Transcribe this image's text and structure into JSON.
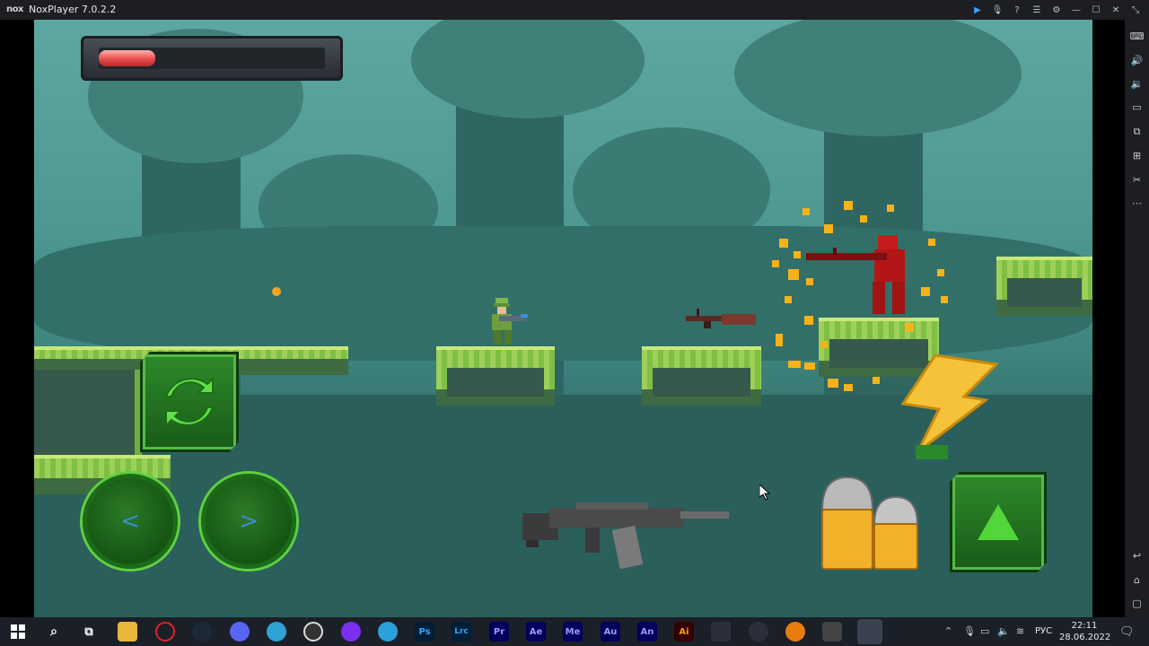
{
  "window": {
    "logo": "nox",
    "title": "NoxPlayer 7.0.2.2",
    "controls": [
      "play-icon",
      "mic-icon",
      "help-icon",
      "menu-icon",
      "settings-icon",
      "minimize-icon",
      "maximize-icon",
      "close-icon",
      "collapse-icon"
    ]
  },
  "sidebar": {
    "icons": [
      "keyboard-icon",
      "volume-up-icon",
      "volume-down-icon",
      "screen-icon",
      "screenshot-icon",
      "apk-icon",
      "cut-icon",
      "more-icon",
      "back-icon",
      "home-icon",
      "recent-apps-icon"
    ]
  },
  "game": {
    "health_fraction": 0.25,
    "left_glyph": "<",
    "right_glyph": ">",
    "colors": {
      "sky": "#5ea7a0",
      "platform": "#9dd05a",
      "health": "#e84a4a",
      "button_green": "#2e8a2a",
      "enemy": "#c41c1c"
    }
  },
  "taskbar": {
    "apps": [
      {
        "name": "windows-start",
        "label": ""
      },
      {
        "name": "search",
        "label": ""
      },
      {
        "name": "task-view",
        "label": ""
      },
      {
        "name": "file-explorer",
        "label": ""
      },
      {
        "name": "opera",
        "label": ""
      },
      {
        "name": "steam",
        "label": ""
      },
      {
        "name": "discord",
        "label": ""
      },
      {
        "name": "edge",
        "label": ""
      },
      {
        "name": "obs",
        "label": ""
      },
      {
        "name": "app-purple",
        "label": ""
      },
      {
        "name": "telegram",
        "label": ""
      },
      {
        "name": "photoshop",
        "label": "Ps"
      },
      {
        "name": "lightroom-classic",
        "label": "Lrc"
      },
      {
        "name": "premiere",
        "label": "Pr"
      },
      {
        "name": "after-effects",
        "label": "Ae"
      },
      {
        "name": "media-encoder",
        "label": "Me"
      },
      {
        "name": "audition",
        "label": "Au"
      },
      {
        "name": "animate",
        "label": "An"
      },
      {
        "name": "illustrator",
        "label": "Ai"
      },
      {
        "name": "app-dark",
        "label": ""
      },
      {
        "name": "app-speaker",
        "label": ""
      },
      {
        "name": "blender",
        "label": ""
      },
      {
        "name": "unity",
        "label": ""
      },
      {
        "name": "noxplayer",
        "label": ""
      }
    ],
    "language": "РУС",
    "time": "22:11",
    "date": "28.06.2022"
  }
}
